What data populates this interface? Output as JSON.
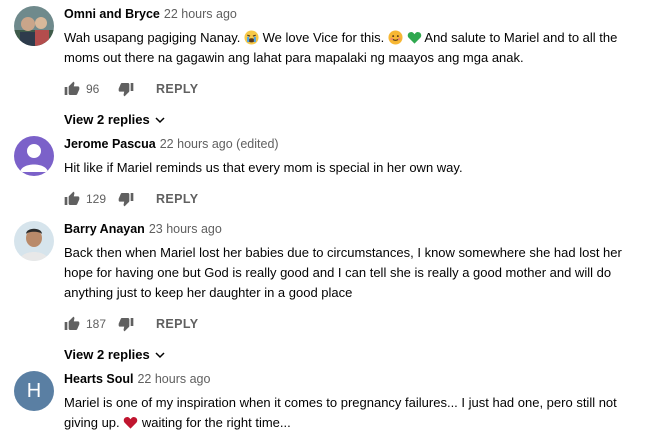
{
  "comments": [
    {
      "author": "Omni and Bryce",
      "time": "22 hours ago",
      "text_a": "Wah usapang pagiging Nanay.",
      "text_b": "We love Vice for this.",
      "text_c": "And salute to Mariel and to all the moms out there na gagawin ang lahat para mapalaki ng maayos ang mga anak.",
      "likes": "96",
      "reply_label": "REPLY",
      "view_replies": "View 2 replies"
    },
    {
      "author": "Jerome Pascua",
      "time": "22 hours ago (edited)",
      "text": "Hit like if Mariel reminds us that every mom is special in her own way.",
      "likes": "129",
      "reply_label": "REPLY"
    },
    {
      "author": "Barry Anayan",
      "time": "23 hours ago",
      "text": "Back then when Mariel lost her babies due to circumstances, I know somewhere she had lost her hope for having one but God is really good and I can tell she is really a good mother and will do anything just to keep her daughter in a good place",
      "likes": "187",
      "reply_label": "REPLY",
      "view_replies": "View 2 replies"
    },
    {
      "author": "Hearts Soul",
      "time": "22 hours ago",
      "avatar_letter": "H",
      "text_a": "Mariel is one of my inspiration when it comes to pregnancy failures... I just had one, pero still not giving up.",
      "text_b": "waiting for the right time..."
    }
  ],
  "colors": {
    "text": "#030303",
    "secondary": "#606060",
    "avatar_default": "#7b61c9",
    "avatar_h": "#5a7fa3"
  },
  "icons": [
    "thumbs-up-icon",
    "thumbs-down-icon",
    "chevron-down-icon",
    "crying-emoji-icon",
    "smiling-emoji-icon",
    "green-heart-icon",
    "red-heart-icon"
  ]
}
